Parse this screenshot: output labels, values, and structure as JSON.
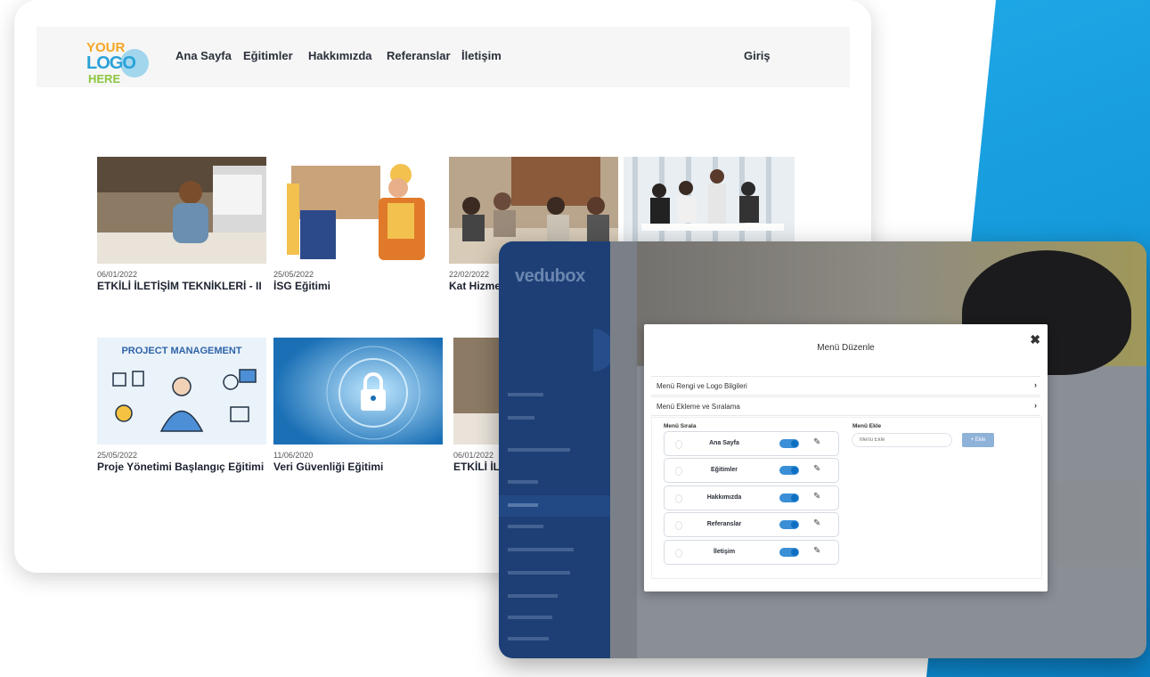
{
  "site": {
    "logo": {
      "line1": "YOUR",
      "line2": "LOGO",
      "line3": "HERE"
    },
    "nav": [
      "Ana Sayfa",
      "Eğitimler",
      "Hakkımızda",
      "Referanslar",
      "İletişim"
    ],
    "login": "Giriş",
    "courses": [
      {
        "date": "06/01/2022",
        "title": "ETKİLİ İLETİŞİM TEKNİKLERİ - II"
      },
      {
        "date": "25/05/2022",
        "title": "İSG Eğitimi"
      },
      {
        "date": "22/02/2022",
        "title": "Kat Hizme"
      },
      {
        "date": "",
        "title": ""
      },
      {
        "date": "25/05/2022",
        "title": "Proje Yönetimi Başlangıç Eğitimi",
        "banner": "PROJECT MANAGEMENT"
      },
      {
        "date": "11/06/2020",
        "title": "Veri Güvenliği Eğitimi"
      },
      {
        "date": "06/01/2022",
        "title": "ETKİLİ İL"
      }
    ]
  },
  "admin": {
    "brand": "vedubox",
    "modal": {
      "title": "Menü Düzenle",
      "close": "✖",
      "accordions": [
        "Menü Rengi ve Logo Bilgileri",
        "Menü Ekleme ve Sıralama"
      ],
      "chevron": "›",
      "sort_label": "Menü Sırala",
      "add_label": "Menü Ekle",
      "input_placeholder": "Menü Ekle",
      "add_button": "+ Ekle",
      "menu_items": [
        "Ana Sayfa",
        "Eğitimler",
        "Hakkımızda",
        "Referanslar",
        "İletişim"
      ],
      "edit_icon": "✎"
    }
  },
  "colors": {
    "accent": "#1593d6",
    "sidebar": "#1d3f76",
    "toggle": "#3a8fd6"
  }
}
